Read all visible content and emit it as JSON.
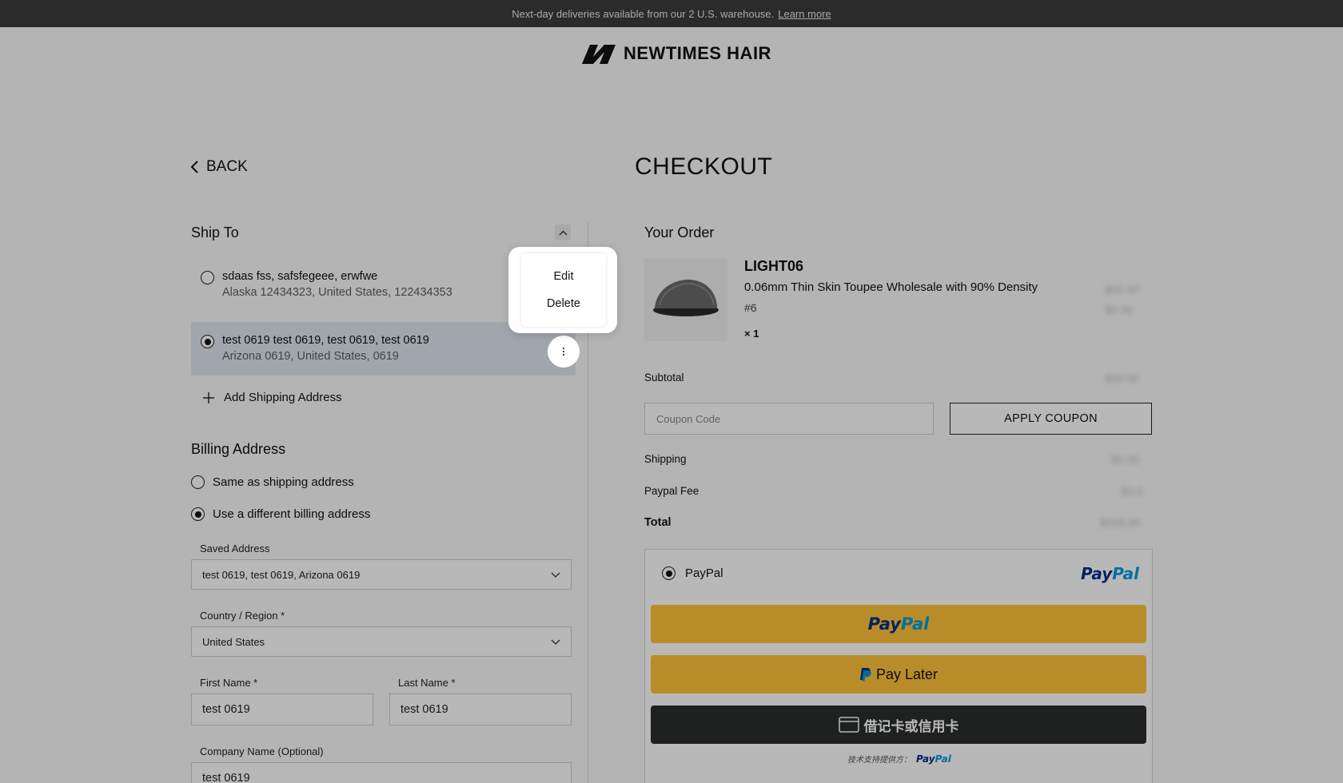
{
  "announcement": {
    "text": "Next-day deliveries available from our 2 U.S. warehouse.",
    "link": "Learn more"
  },
  "brand": {
    "name": "NEWTIMES HAIR"
  },
  "nav": {
    "back_label": "BACK"
  },
  "page": {
    "title": "CHECKOUT"
  },
  "ship_to": {
    "title": "Ship To",
    "addresses": [
      {
        "line1": "sdaas fss, safsfegeee, erwfwe",
        "line2": "Alaska 12434323, United States, 122434353",
        "selected": false
      },
      {
        "line1": "test 0619 test 0619, test 0619, test 0619",
        "line2": "Arizona 0619, United States, 0619",
        "selected": true
      }
    ],
    "add_label": "Add Shipping Address",
    "menu": {
      "edit": "Edit",
      "delete": "Delete"
    }
  },
  "billing": {
    "title": "Billing Address",
    "options": [
      {
        "label": "Same as shipping address",
        "selected": false
      },
      {
        "label": "Use a different billing address",
        "selected": true
      }
    ],
    "saved_address_label": "Saved Address",
    "saved_address_value": "test 0619, test 0619, Arizona 0619",
    "country_label": "Country / Region *",
    "country_value": "United States",
    "first_name_label": "First Name *",
    "first_name_value": "test 0619",
    "last_name_label": "Last Name *",
    "last_name_value": "test 0619",
    "company_label": "Company Name (Optional)",
    "company_value": "test 0619"
  },
  "order": {
    "title": "Your Order",
    "product": {
      "name": "LIGHT06",
      "description": "0.06mm Thin Skin Toupee Wholesale with 90% Density",
      "variant": "#6",
      "qty": "× 1"
    },
    "subtotal_label": "Subtotal",
    "coupon_placeholder": "Coupon Code",
    "coupon_button": "APPLY COUPON",
    "shipping_label": "Shipping",
    "paypal_fee_label": "Paypal Fee",
    "total_label": "Total"
  },
  "payment": {
    "method_label": "PayPal",
    "logo_pay": "Pay",
    "logo_pal": "Pal",
    "pay_later_label": "Pay Later",
    "card_label": "借记卡或信用卡",
    "powered_by": "技术支持提供方："
  },
  "colors": {
    "paypal_gold": "#ffc439",
    "paypal_dark": "#2c2e2f",
    "paypal_blue": "#003087",
    "paypal_light_blue": "#009cde",
    "selected_row": "#dfe6f0"
  }
}
